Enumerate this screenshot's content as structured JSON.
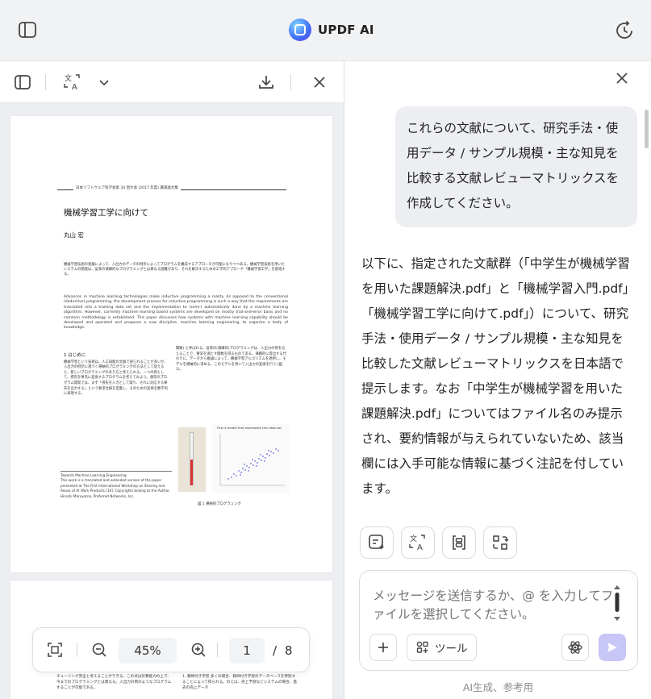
{
  "app": {
    "title": "UPDF AI"
  },
  "pdf": {
    "header": "日本ソフトウェア科学会第 34 回大会 (2017 年度) 講演論文集",
    "title": "機械学習工学に向けて",
    "author": "丸山 宏",
    "abstract_jp": "機械学習技術の発展によって、入出力のデータの例示によってプログラムを構成するアプローチが可能になりつつある。機械学習技術を用いたシステムの開発は、従来の演繹的なプログラミングとは異なる困難があり、それを解決するための工学的アプローチ「機械学習工学」を提唱する。",
    "abstract_en": "Advances in machine learning technologies make inductive programming a reality. As opposed to the conventional (deductive) programming, the development process for inductive programming is such a way that the requirements are translated into a training data set and the implementation to (semi-) automatically done by a machine learning algorithm. However, currently machine learning based systems are developed on mostly trial-and-error basis and no common methodology is established. This paper discusses how systems with machine learning capability should be developed and operated and proposes a new discipline, machine learning engineering, to organize a body of knowledge.",
    "section_heading": "1 はじめに",
    "col_left": "機械学習という技術は、人工知能の文脈で語られることが多いが、入出力の例示に基づく帰納的プログラミングの方法として捉えると、新しいプログラミングのあり方と考えられる。一つの例として、摂氏を華氏に変換するプログラムを考えてみよう。通常のプログラム開発では、まず「摂氏を入力として取り、それに対応する華氏を出力する」という要求仕様を定義し、そのための変換を数学的に表現する。",
    "col_right": "関数) と呼ばれる。従来の(演繹的)プログラミングは、入出力の例を与えることで、要求を満たす関数を得るものである。演繹的に導出する代わりに、データから推論によって、機械学習アルゴリズムを適用し、モデルを帰納的に求める。このモデルを用いて入出力の変換を行う (図 1)。",
    "footnote": "Towards Machine Learning Engineering\nThis work is a translated and extended version of the paper presented at The First International Workshop on Sharing and Reuse of AI Work Products [16]. Copyrights belong to the Author.\nHiroshi Maruyama, Preferred Networks, Inc.",
    "figure_title": "First a model that represents this data set",
    "figure_caption": "図 1 帰納的プログラミング",
    "page2_left": "チューリング完全と考えることができる。この点は計算能力の上で、今までのプログラミングとは異なる。入出力の例のようなプログラムすることが可能である。",
    "page2_right": "1. 教師付き学習 多くの場合、教師付き学習のデータベースを参照することによって得られる。のえば、売上予測などシステムの場合、過去の売上データ"
  },
  "zoom": {
    "value": "45%",
    "current_page": "1",
    "slash": "/",
    "total_pages": "8"
  },
  "chat": {
    "user_message": "これらの文献について、研究手法・使用データ / サンプル規模・主な知見を比較する文献レビューマトリックスを作成してください。",
    "ai_answer": "以下に、指定された文献群（「中学生が機械学習を用いた課題解決.pdf」と「機械学習入門.pdf」「機械学習工学に向けて.pdf」）について、研究手法・使用データ / サンプル規模・主な知見を比較した文献レビューマトリックスを日本語で提示します。なお「中学生が機械学習を用いた課題解決.pdf」についてはファイル名のみ提示され、要約情報が与えられていないため、該当欄には入手可能な情報に基づく注記を付しています。",
    "input_placeholder": "メッセージを送信するか、@ を入力してファイルを選択してください。",
    "tools_label": "ツール",
    "disclaimer": "AI生成、参考用"
  },
  "colors": {
    "accent": "#c7c6f7",
    "bubble": "#eceef1",
    "topbar": "#f1f2f4"
  },
  "icons": [
    "sidebar-icon",
    "history-icon",
    "translate-icon",
    "chevron-down-icon",
    "download-icon",
    "close-icon",
    "fit-icon",
    "zoom-out-icon",
    "zoom-in-icon",
    "summarize-icon",
    "explain-icon",
    "rewrite-icon",
    "plus-icon",
    "tools-icon",
    "model-icon",
    "send-icon"
  ]
}
